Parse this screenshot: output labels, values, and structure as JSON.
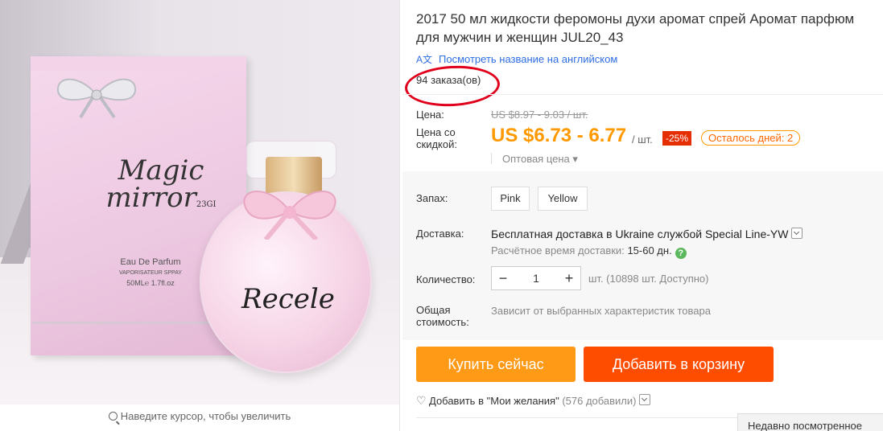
{
  "product": {
    "title": "2017 50 мл жидкости феромоны духи аромат спрей Аромат парфюм для мужчин и женщин JUL20_43",
    "translate_link": "Посмотреть название на английском",
    "translate_icon": "translate-icon",
    "orders": "94 заказа(ов)"
  },
  "image": {
    "box_brand": "Magic mirror",
    "box_small": "23GI",
    "box_line1": "Eau De Parfum",
    "box_line2": "VAPORISATEUR SPPAY",
    "box_line3": "50ML℮     1.7fl.oz",
    "bottle_label": "Recele",
    "zoom_hint": "Наведите курсор, чтобы увеличить"
  },
  "price": {
    "label": "Цена:",
    "original": "US $8.97 - 9.03 / шт.",
    "sale_label": "Цена со скидкой:",
    "sale": "US $6.73 - 6.77",
    "unit": "/ шт.",
    "discount": "-25%",
    "days_left": "Осталось дней: 2",
    "wholesale": "Оптовая цена ▾"
  },
  "options": {
    "scent_label": "Запах:",
    "scents": [
      "Pink",
      "Yellow"
    ],
    "shipping_label": "Доставка:",
    "shipping": "Бесплатная доставка в Ukraine службой Special Line-YW",
    "estimate_label": "Расчётное время доставки:",
    "estimate_value": "15-60 дн.",
    "quantity_label": "Количество:",
    "quantity": "1",
    "stock": "шт. (10898 шт. Доступно)",
    "total_label": "Общая стоимость:",
    "total_value": "Зависит от выбранных характеристик товара"
  },
  "actions": {
    "buy_now": "Купить сейчас",
    "add_to_cart": "Добавить в корзину",
    "wishlist": "Добавить в \"Мои желания\"",
    "wishlist_count": "(576 добавили)"
  },
  "recent_tab": "Недавно посмотренное",
  "colors": {
    "accent_orange": "#ff9900",
    "cart_orange": "#ff4400",
    "discount_red": "#e62e04",
    "link_blue": "#2f6ee2"
  }
}
